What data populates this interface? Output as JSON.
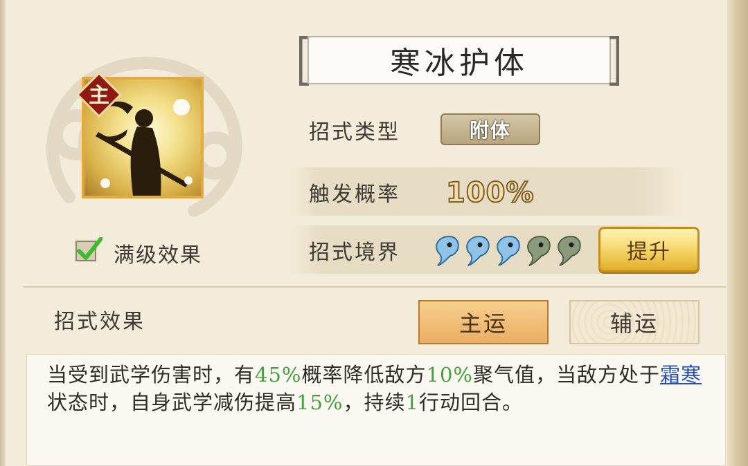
{
  "skill": {
    "name": "寒冰护体",
    "badge": "主",
    "max_level_label": "满级效果",
    "max_level_checked": true
  },
  "attributes": {
    "type_label": "招式类型",
    "type_value": "附体",
    "rate_label": "触发概率",
    "rate_value": "100%",
    "realm_label": "招式境界",
    "realm_total": 5,
    "realm_filled": 3,
    "upgrade_button": "提升"
  },
  "effect": {
    "section_label": "招式效果",
    "tab_main": "主运",
    "tab_aux": "辅运",
    "description": {
      "p1": "当受到武学伤害时，有",
      "v1": "45%",
      "p2": "概率降低敌方",
      "v2": "10%",
      "p3": "聚气值，当敌方处于",
      "link": "霜寒",
      "p4": "状态时，自身武学减伤提高",
      "v3": "15%",
      "p5": "，持续",
      "v4": "1",
      "p6": "行动回合。"
    }
  },
  "colors": {
    "highlight": "#3ea33a",
    "link": "#2a4fb3",
    "frame_gold": "#e7a93b"
  }
}
